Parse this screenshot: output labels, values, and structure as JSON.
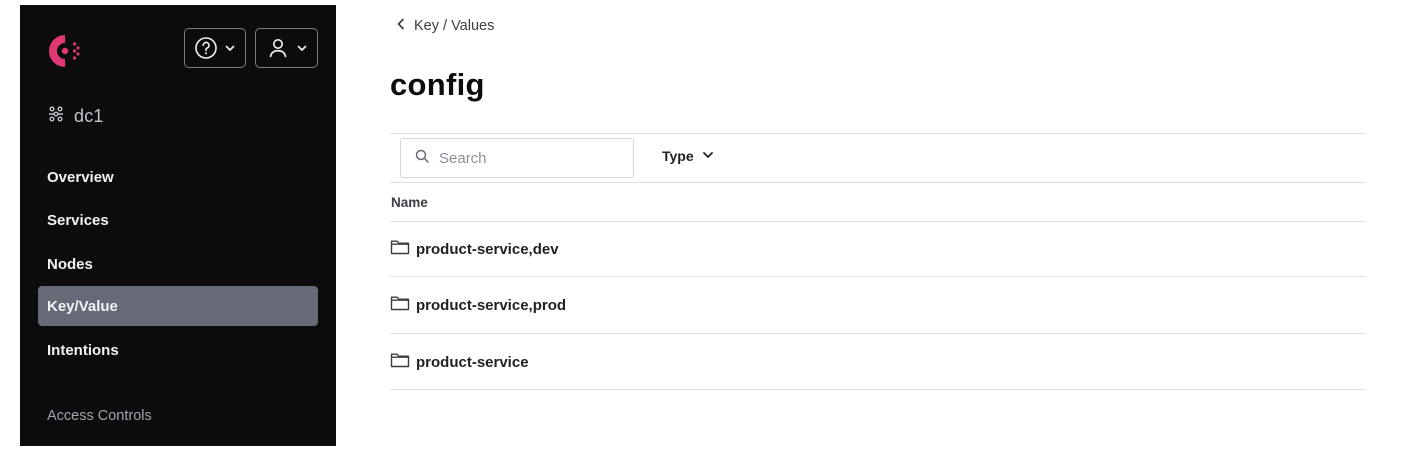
{
  "sidebar": {
    "datacenter": "dc1",
    "nav": [
      {
        "label": "Overview"
      },
      {
        "label": "Services"
      },
      {
        "label": "Nodes"
      },
      {
        "label": "Key/Value",
        "active": true
      },
      {
        "label": "Intentions"
      }
    ],
    "section_heading": "Access Controls",
    "icons": {
      "logo": "consul-logo",
      "help": "help-circle-icon",
      "user": "user-icon"
    }
  },
  "main": {
    "breadcrumb": "Key / Values",
    "title": "config",
    "search": {
      "placeholder": "Search",
      "value": ""
    },
    "type_filter": "Type",
    "column_header": "Name",
    "rows": [
      {
        "name": "product-service,dev",
        "icon": "folder-icon"
      },
      {
        "name": "product-service,prod",
        "icon": "folder-icon"
      },
      {
        "name": "product-service",
        "icon": "folder-icon"
      }
    ]
  },
  "colors": {
    "sidebar_bg": "#0c0c0e",
    "active_nav": "#656a76",
    "brand": "#e03875"
  }
}
